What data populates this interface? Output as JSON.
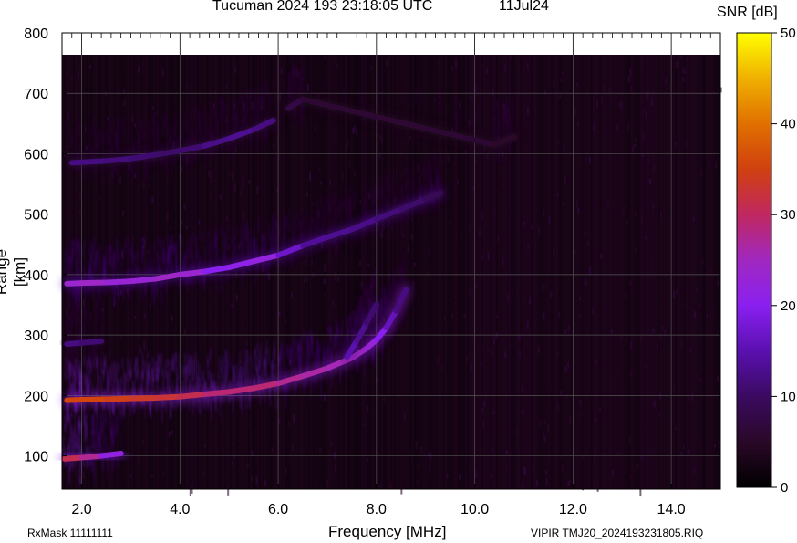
{
  "header": {
    "title": "Tucuman 2024 193 23:18:05 UTC",
    "date": "11Jul24"
  },
  "colorbar": {
    "label": "SNR [dB]",
    "range": [
      0,
      50
    ],
    "ticks": [
      "0",
      "10",
      "20",
      "30",
      "40",
      "50"
    ],
    "colors": [
      "#000000",
      "#3a0a3a",
      "#5b0f8a",
      "#7a1ee0",
      "#a020f0",
      "#c02040",
      "#d04010",
      "#e07000",
      "#f0b000",
      "#ffff00"
    ]
  },
  "footer": {
    "rxmask": "RxMask 11111111",
    "filename": "VIPIR  TMJ20_2024193231805.RIQ"
  },
  "chart_data": {
    "type": "heatmap",
    "title": "Tucuman 2024 193 23:18:05 UTC",
    "xlabel": "Frequency [MHz]",
    "ylabel": "Range [km]",
    "xlim": [
      1.6,
      15.0
    ],
    "ylim": [
      45,
      800
    ],
    "xticks": [
      "2.0",
      "4.0",
      "6.0",
      "8.0",
      "10.0",
      "12.0",
      "14.0"
    ],
    "xtick_values": [
      2,
      4,
      6,
      8,
      10,
      12,
      14
    ],
    "yticks": [
      "100",
      "200",
      "300",
      "400",
      "500",
      "600",
      "700",
      "800"
    ],
    "ytick_values": [
      100,
      200,
      300,
      400,
      500,
      600,
      700,
      800
    ],
    "grid": true,
    "colorbar_label": "SNR [dB]",
    "traces": [
      {
        "name": "",
        "points": [
          [
            1.65,
            95,
            32
          ],
          [
            2.0,
            97,
            30
          ],
          [
            2.4,
            100,
            25
          ],
          [
            2.8,
            104,
            18
          ]
        ]
      },
      {
        "name": "",
        "points": [
          [
            1.7,
            192,
            35
          ],
          [
            2.0,
            193,
            36
          ],
          [
            2.5,
            194,
            35
          ],
          [
            3.0,
            195,
            34
          ],
          [
            3.5,
            196,
            33
          ],
          [
            4.0,
            198,
            32
          ],
          [
            4.5,
            202,
            30
          ],
          [
            5.0,
            206,
            28
          ],
          [
            5.5,
            212,
            30
          ],
          [
            6.0,
            220,
            28
          ],
          [
            6.5,
            232,
            27
          ],
          [
            7.0,
            245,
            26
          ],
          [
            7.5,
            262,
            25
          ],
          [
            7.8,
            278,
            24
          ],
          [
            8.0,
            292,
            22
          ],
          [
            8.2,
            312,
            18
          ],
          [
            8.4,
            340,
            14
          ],
          [
            8.6,
            375,
            10
          ]
        ]
      },
      {
        "name": "",
        "points": [
          [
            7.4,
            264,
            16
          ],
          [
            7.6,
            290,
            14
          ],
          [
            7.8,
            320,
            12
          ],
          [
            8.0,
            350,
            10
          ]
        ]
      },
      {
        "name": "",
        "points": [
          [
            1.7,
            285,
            12
          ],
          [
            2.0,
            287,
            12
          ],
          [
            2.4,
            290,
            10
          ]
        ]
      },
      {
        "name": "",
        "points": [
          [
            1.7,
            385,
            22
          ],
          [
            2.0,
            386,
            25
          ],
          [
            2.5,
            387,
            24
          ],
          [
            3.0,
            389,
            22
          ],
          [
            3.5,
            393,
            24
          ],
          [
            4.0,
            400,
            25
          ],
          [
            4.5,
            405,
            22
          ],
          [
            5.0,
            412,
            18
          ],
          [
            5.5,
            422,
            24
          ],
          [
            6.0,
            432,
            20
          ],
          [
            6.5,
            448,
            14
          ],
          [
            7.0,
            462,
            13
          ],
          [
            7.5,
            475,
            13
          ],
          [
            8.0,
            492,
            12
          ],
          [
            8.5,
            508,
            11
          ],
          [
            9.0,
            525,
            10
          ],
          [
            9.3,
            535,
            8
          ]
        ]
      },
      {
        "name": "",
        "points": [
          [
            1.8,
            585,
            12
          ],
          [
            2.5,
            588,
            12
          ],
          [
            3.0,
            592,
            11
          ],
          [
            3.5,
            598,
            11
          ],
          [
            4.0,
            605,
            10
          ],
          [
            4.5,
            613,
            12
          ],
          [
            5.0,
            625,
            13
          ],
          [
            5.5,
            640,
            13
          ],
          [
            5.9,
            655,
            11
          ]
        ]
      },
      {
        "name": "",
        "points": [
          [
            6.2,
            675,
            8
          ],
          [
            6.5,
            690,
            7
          ],
          [
            10.4,
            615,
            5
          ],
          [
            10.8,
            628,
            5
          ]
        ]
      }
    ]
  }
}
